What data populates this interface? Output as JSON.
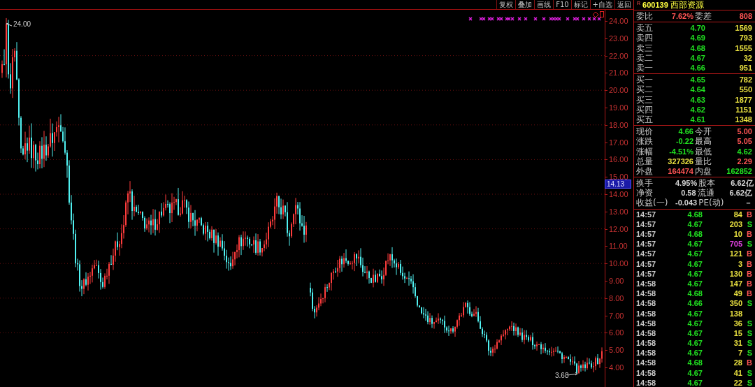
{
  "toolbar": {
    "buttons": [
      "复权",
      "叠加",
      "画线",
      "F10",
      "标记",
      "+自选",
      "返回"
    ]
  },
  "chart": {
    "price_axis": [
      "24.00",
      "23.00",
      "22.00",
      "21.00",
      "20.00",
      "19.00",
      "18.00",
      "17.00",
      "16.00",
      "15.00",
      "14.00",
      "13.00",
      "12.00",
      "11.00",
      "10.00",
      "9.00",
      "8.00",
      "7.00",
      "6.00",
      "5.00",
      "4.00"
    ],
    "cursor_price": "14.13",
    "high_label": "24.00",
    "low_label": "3.68"
  },
  "quote_header": {
    "flag": "R",
    "code": "600139",
    "name": "西部资源"
  },
  "order_ratio": {
    "label": "委比",
    "value": {
      "text": "7.62%",
      "color": "#ff5454"
    },
    "diff_label": "委差",
    "diff": {
      "text": "808",
      "color": "#ff5454"
    }
  },
  "asks": [
    {
      "label": "卖五",
      "price": "4.70",
      "volume": "1569"
    },
    {
      "label": "卖四",
      "price": "4.69",
      "volume": "793"
    },
    {
      "label": "卖三",
      "price": "4.68",
      "volume": "1555"
    },
    {
      "label": "卖二",
      "price": "4.67",
      "volume": "32"
    },
    {
      "label": "卖一",
      "price": "4.66",
      "volume": "951"
    }
  ],
  "bids": [
    {
      "label": "买一",
      "price": "4.65",
      "volume": "782"
    },
    {
      "label": "买二",
      "price": "4.64",
      "volume": "550"
    },
    {
      "label": "买三",
      "price": "4.63",
      "volume": "1877"
    },
    {
      "label": "买四",
      "price": "4.62",
      "volume": "1151"
    },
    {
      "label": "买五",
      "price": "4.61",
      "volume": "1348"
    }
  ],
  "quote_rows": [
    {
      "label": "现价",
      "value": {
        "text": "4.66",
        "color": "#20e020"
      },
      "label2": "今开",
      "value2": {
        "text": "5.00",
        "color": "#ff5454"
      }
    },
    {
      "label": "涨跌",
      "value": {
        "text": "-0.22",
        "color": "#20e020"
      },
      "label2": "最高",
      "value2": {
        "text": "5.05",
        "color": "#ff5454"
      }
    },
    {
      "label": "涨幅",
      "value": {
        "text": "-4.51%",
        "color": "#20e020"
      },
      "label2": "最低",
      "value2": {
        "text": "4.62",
        "color": "#20e020"
      }
    },
    {
      "label": "总量",
      "value": {
        "text": "327326",
        "color": "#e8e040"
      },
      "label2": "量比",
      "value2": {
        "text": "2.29",
        "color": "#ff5454"
      }
    },
    {
      "label": "外盘",
      "value": {
        "text": "164474",
        "color": "#ff5454"
      },
      "label2": "内盘",
      "value2": {
        "text": "162852",
        "color": "#20e020"
      }
    }
  ],
  "stats": [
    {
      "label": "换手",
      "value": "4.95%",
      "label2": "股本",
      "value2": "6.62亿"
    },
    {
      "label": "净资",
      "value": "0.58",
      "label2": "流通",
      "value2": "6.62亿"
    },
    {
      "label": "收益(一)",
      "value": "-0.043",
      "label2": "PE(动)",
      "value2": "－"
    }
  ],
  "ticks": [
    {
      "time": "14:57",
      "price": "4.68",
      "volume": {
        "text": "84",
        "color": "#e8e040"
      },
      "side": {
        "text": "B",
        "color": "#ff5454"
      }
    },
    {
      "time": "14:57",
      "price": "4.67",
      "volume": {
        "text": "203",
        "color": "#e8e040"
      },
      "side": {
        "text": "S",
        "color": "#20e020"
      }
    },
    {
      "time": "14:57",
      "price": "4.68",
      "volume": {
        "text": "10",
        "color": "#e8e040"
      },
      "side": {
        "text": "B",
        "color": "#ff5454"
      }
    },
    {
      "time": "14:57",
      "price": "4.67",
      "volume": {
        "text": "705",
        "color": "#e040e0"
      },
      "side": {
        "text": "S",
        "color": "#20e020"
      }
    },
    {
      "time": "14:57",
      "price": "4.67",
      "volume": {
        "text": "121",
        "color": "#e8e040"
      },
      "side": {
        "text": "B",
        "color": "#ff5454"
      }
    },
    {
      "time": "14:57",
      "price": "4.67",
      "volume": {
        "text": "3",
        "color": "#e8e040"
      },
      "side": {
        "text": "B",
        "color": "#ff5454"
      }
    },
    {
      "time": "14:57",
      "price": "4.67",
      "volume": {
        "text": "130",
        "color": "#e8e040"
      },
      "side": {
        "text": "B",
        "color": "#ff5454"
      }
    },
    {
      "time": "14:58",
      "price": "4.67",
      "volume": {
        "text": "147",
        "color": "#e8e040"
      },
      "side": {
        "text": "B",
        "color": "#ff5454"
      }
    },
    {
      "time": "14:58",
      "price": "4.68",
      "volume": {
        "text": "49",
        "color": "#e8e040"
      },
      "side": {
        "text": "B",
        "color": "#ff5454"
      }
    },
    {
      "time": "14:58",
      "price": "4.66",
      "volume": {
        "text": "350",
        "color": "#e8e040"
      },
      "side": {
        "text": "S",
        "color": "#20e020"
      }
    },
    {
      "time": "14:58",
      "price": "4.67",
      "volume": {
        "text": "138",
        "color": "#e8e040"
      }
    },
    {
      "time": "14:58",
      "price": "4.67",
      "volume": {
        "text": "36",
        "color": "#e8e040"
      },
      "side": {
        "text": "S",
        "color": "#20e020"
      }
    },
    {
      "time": "14:58",
      "price": "4.67",
      "volume": {
        "text": "15",
        "color": "#e8e040"
      },
      "side": {
        "text": "S",
        "color": "#20e020"
      }
    },
    {
      "time": "14:58",
      "price": "4.67",
      "volume": {
        "text": "31",
        "color": "#e8e040"
      },
      "side": {
        "text": "S",
        "color": "#20e020"
      }
    },
    {
      "time": "14:58",
      "price": "4.67",
      "volume": {
        "text": "7",
        "color": "#e8e040"
      },
      "side": {
        "text": "S",
        "color": "#20e020"
      }
    },
    {
      "time": "14:58",
      "price": "4.68",
      "volume": {
        "text": "28",
        "color": "#e8e040"
      },
      "side": {
        "text": "B",
        "color": "#ff5454"
      }
    },
    {
      "time": "14:58",
      "price": "4.67",
      "volume": {
        "text": "41",
        "color": "#e8e040"
      },
      "side": {
        "text": "S",
        "color": "#20e020"
      }
    },
    {
      "time": "14:58",
      "price": "4.67",
      "volume": {
        "text": "22",
        "color": "#e8e040"
      },
      "side": {
        "text": "S",
        "color": "#20e020"
      }
    }
  ]
}
